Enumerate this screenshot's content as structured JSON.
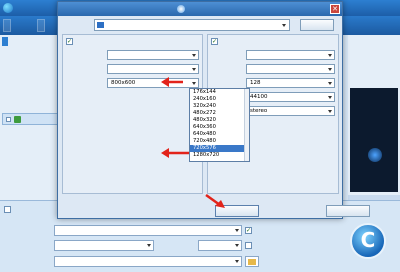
{
  "app": {
    "title": "",
    "menu": [
      "",
      "",
      "",
      ""
    ],
    "sidebar": {
      "tab": "",
      "rows": [
        "",
        "",
        ""
      ],
      "file_name": ""
    },
    "right_links": [
      "",
      ""
    ],
    "bottom": {
      "subtitle_label": "",
      "preset_label": "",
      "preset_value": "",
      "video_quality_label": "",
      "video_quality_value": "",
      "audio_quality_label": "",
      "audio_quality_value": "",
      "output_dir_label": "",
      "output_dir_value": "",
      "apply_all_label": "",
      "merge_label": ""
    },
    "convert_glyph": "C"
  },
  "dialog": {
    "title": "",
    "close_glyph": "✕",
    "preset_label": "",
    "preset_value": "",
    "save_as": "",
    "video": {
      "group_title": "",
      "codec_label": "",
      "codec_value": "",
      "quality_label": "",
      "quality_value": "",
      "size_label": "",
      "size_value": "800x600",
      "bitrate_label": "",
      "fps_label": "",
      "aspect_label": ""
    },
    "audio": {
      "group_title": "",
      "codec_label": "",
      "codec_value": "",
      "quality_label": "",
      "quality_value": "",
      "bitrate_label": "",
      "bitrate_value": "128",
      "samplerate_label": "",
      "samplerate_value": "44100",
      "channel_label": "",
      "channel_value": "stereo"
    },
    "size_options": [
      "176x144",
      "240x160",
      "320x240",
      "480x272",
      "480x320",
      "640x360",
      "640x480",
      "720x480",
      "720x576",
      "1280x720"
    ],
    "selected_size": "720x576",
    "ok_label": "",
    "close_label": ""
  },
  "colors": {
    "accent": "#2d7fd1",
    "selection": "#3a78c8",
    "annotation_arrow": "#e2231a"
  }
}
